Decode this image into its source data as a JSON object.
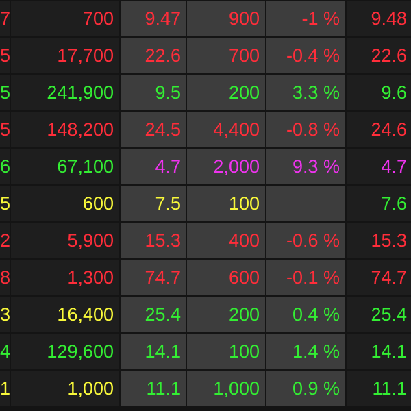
{
  "colors": {
    "red": "#ff2d3a",
    "green": "#33ee33",
    "yellow": "#f8f83a",
    "magenta": "#ee33ee"
  },
  "rows": [
    {
      "code_tail": "7",
      "volume": "700",
      "price": "9.47",
      "qty": "900",
      "change": "-1 %",
      "last": "9.48",
      "vol_color": "red",
      "price_color": "red",
      "last_color": "red"
    },
    {
      "code_tail": "5",
      "volume": "17,700",
      "price": "22.6",
      "qty": "700",
      "change": "-0.4 %",
      "last": "22.6",
      "vol_color": "red",
      "price_color": "red",
      "last_color": "red"
    },
    {
      "code_tail": "5",
      "volume": "241,900",
      "price": "9.5",
      "qty": "200",
      "change": "3.3 %",
      "last": "9.6",
      "vol_color": "green",
      "price_color": "green",
      "last_color": "green"
    },
    {
      "code_tail": "5",
      "volume": "148,200",
      "price": "24.5",
      "qty": "4,400",
      "change": "-0.8 %",
      "last": "24.6",
      "vol_color": "red",
      "price_color": "red",
      "last_color": "red"
    },
    {
      "code_tail": "6",
      "volume": "67,100",
      "price": "4.7",
      "qty": "2,000",
      "change": "9.3 %",
      "last": "4.7",
      "vol_color": "green",
      "price_color": "magenta",
      "last_color": "magenta"
    },
    {
      "code_tail": "5",
      "volume": "600",
      "price": "7.5",
      "qty": "100",
      "change": "",
      "last": "7.6",
      "vol_color": "yellow",
      "price_color": "yellow",
      "last_color": "green"
    },
    {
      "code_tail": "2",
      "volume": "5,900",
      "price": "15.3",
      "qty": "400",
      "change": "-0.6 %",
      "last": "15.3",
      "vol_color": "red",
      "price_color": "red",
      "last_color": "red"
    },
    {
      "code_tail": "8",
      "volume": "1,300",
      "price": "74.7",
      "qty": "600",
      "change": "-0.1 %",
      "last": "74.7",
      "vol_color": "red",
      "price_color": "red",
      "last_color": "red"
    },
    {
      "code_tail": "3",
      "volume": "16,400",
      "price": "25.4",
      "qty": "200",
      "change": "0.4 %",
      "last": "25.4",
      "vol_color": "yellow",
      "price_color": "green",
      "last_color": "green"
    },
    {
      "code_tail": "4",
      "volume": "129,600",
      "price": "14.1",
      "qty": "100",
      "change": "1.4 %",
      "last": "14.1",
      "vol_color": "green",
      "price_color": "green",
      "last_color": "green"
    },
    {
      "code_tail": "1",
      "volume": "1,000",
      "price": "11.1",
      "qty": "1,000",
      "change": "0.9 %",
      "last": "11.1",
      "vol_color": "yellow",
      "price_color": "green",
      "last_color": "green"
    }
  ]
}
